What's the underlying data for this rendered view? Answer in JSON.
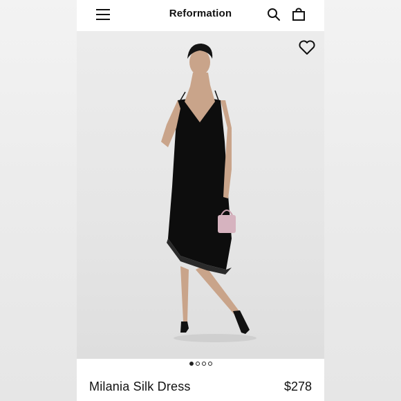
{
  "header": {
    "brand": "Reformation",
    "menu_icon": "hamburger-menu-icon",
    "search_icon": "search-icon",
    "bag_icon": "shopping-bag-icon"
  },
  "gallery": {
    "favorite_icon": "heart-icon",
    "image_description": "Model wearing black lace-trimmed slip midi dress holding pink handbag",
    "total_images": 4,
    "active_index": 1
  },
  "product": {
    "name": "Milania Silk Dress",
    "price": "$278"
  },
  "colors": {
    "text": "#111111",
    "background": "#ffffff",
    "hero_bg": "#e8e8e8"
  }
}
